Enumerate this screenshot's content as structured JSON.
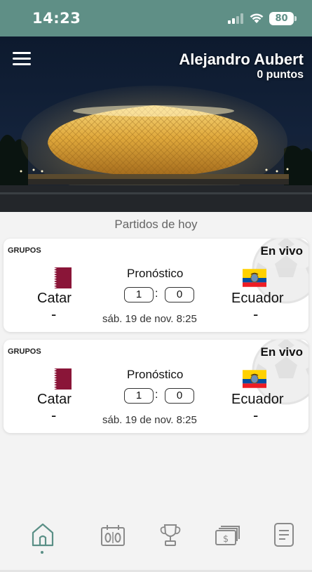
{
  "status_bar": {
    "time": "14:23",
    "battery": "80"
  },
  "header": {
    "user_name": "Alejandro Aubert",
    "points": "0 puntos"
  },
  "section_title": "Partidos de hoy",
  "matches": [
    {
      "group": "GRUPOS",
      "status": "En vivo",
      "home_team": "Catar",
      "away_team": "Ecuador",
      "home_score": "-",
      "away_score": "-",
      "prediction_label": "Pronóstico",
      "prediction_home": "1",
      "prediction_away": "0",
      "separator": ":",
      "date": "sáb. 19 de nov. 8:25"
    },
    {
      "group": "GRUPOS",
      "status": "En vivo",
      "home_team": "Catar",
      "away_team": "Ecuador",
      "home_score": "-",
      "away_score": "-",
      "prediction_label": "Pronóstico",
      "prediction_home": "1",
      "prediction_away": "0",
      "separator": ":",
      "date": "sáb. 19 de nov. 8:25"
    }
  ],
  "nav": {
    "items": [
      {
        "icon": "home-icon",
        "active": true
      },
      {
        "icon": "calendar-scoreboard-icon",
        "active": false
      },
      {
        "icon": "trophy-icon",
        "active": false
      },
      {
        "icon": "money-icon",
        "active": false
      },
      {
        "icon": "document-icon",
        "active": false
      }
    ]
  },
  "colors": {
    "status_bar": "#5f8f86",
    "accent": "#5a8f86",
    "nav_icon": "#8a8a8a",
    "qatar_flag": "#8a1538",
    "ecuador_yellow": "#ffd100",
    "ecuador_blue": "#034ea2",
    "ecuador_red": "#ed1c24"
  }
}
